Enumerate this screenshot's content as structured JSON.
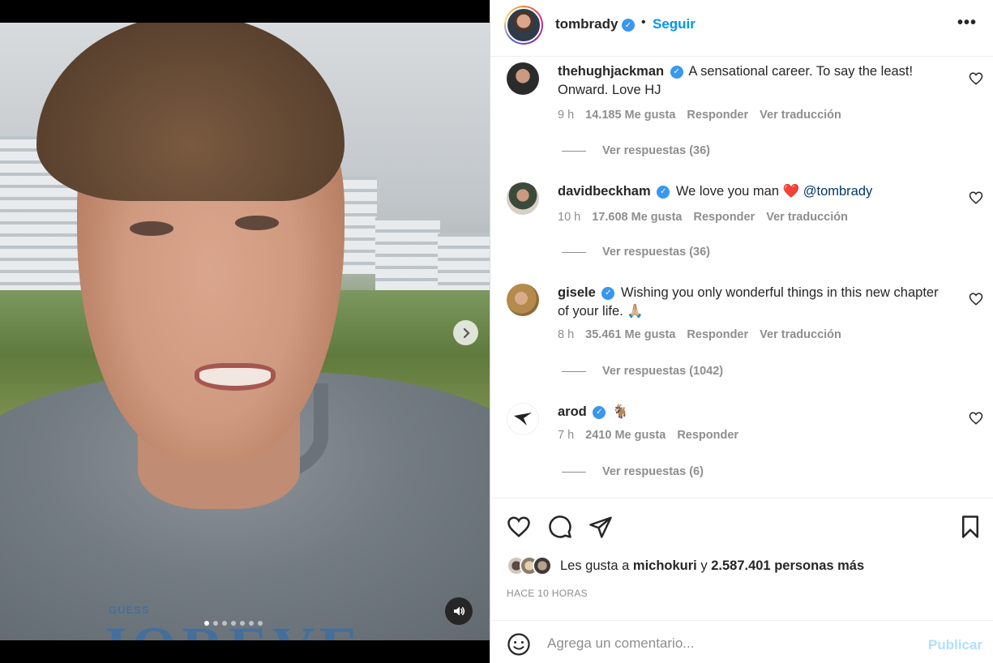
{
  "post": {
    "username": "tombrady",
    "follow_label": "Seguir",
    "separator": "•",
    "more_label": "•••",
    "media": {
      "shirt_brand": "GUESS",
      "shirt_text": "JOREVE",
      "slide_count": 7,
      "active_slide": 1
    }
  },
  "comments": [
    {
      "username": "thehughjackman",
      "text": "A sensational career. To say the least! Onward. Love HJ",
      "time": "9 h",
      "likes": "14.185 Me gusta",
      "reply_label": "Responder",
      "translate_label": "Ver traducción",
      "replies_label": "Ver respuestas (36)"
    },
    {
      "username": "davidbeckham",
      "text": "We love you man ❤️",
      "mention": "@tombrady",
      "time": "10 h",
      "likes": "17.608 Me gusta",
      "reply_label": "Responder",
      "translate_label": "Ver traducción",
      "replies_label": "Ver respuestas (36)"
    },
    {
      "username": "gisele",
      "text": "Wishing you only wonderful things in this new chapter of your life. 🙏🏼",
      "time": "8 h",
      "likes": "35.461 Me gusta",
      "reply_label": "Responder",
      "translate_label": "Ver traducción",
      "replies_label": "Ver respuestas (1042)"
    },
    {
      "username": "arod",
      "text": "🐐",
      "time": "7 h",
      "likes": "2410 Me gusta",
      "reply_label": "Responder",
      "replies_label": "Ver respuestas (6)"
    }
  ],
  "likes_summary": {
    "prefix": "Les gusta a",
    "user": "michokuri",
    "conjunction": "y",
    "others": "2.587.401 personas más"
  },
  "time_ago": "HACE 10 HORAS",
  "comment_box": {
    "placeholder": "Agrega un comentario...",
    "publish_label": "Publicar"
  },
  "colors": {
    "accent": "#0095f6",
    "verified": "#3897f0",
    "muted": "#8e8e8e",
    "publish_disabled": "#b2dffc"
  },
  "icons": {
    "heart": "heart-icon",
    "comment": "comment-icon",
    "share": "share-icon",
    "save": "bookmark-icon",
    "emoji": "emoji-icon",
    "verified": "verified-badge-icon",
    "mute": "speaker-icon",
    "next": "chevron-right-icon"
  }
}
